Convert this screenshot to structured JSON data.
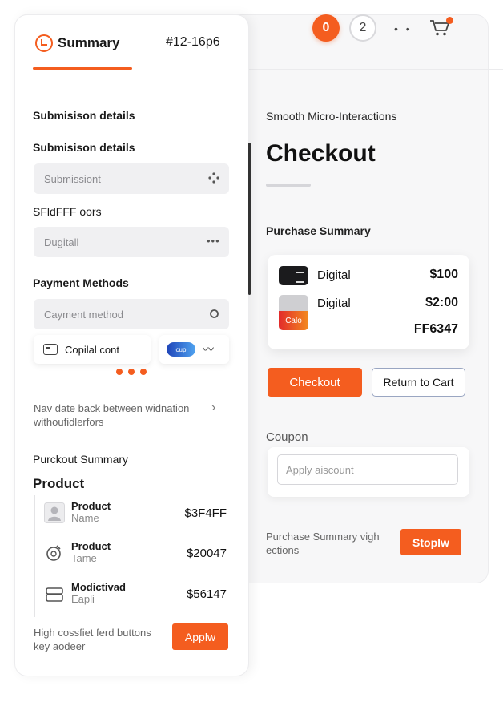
{
  "header": {
    "tab_label": "Summary",
    "order_id": "#12-16p6",
    "badge_active": "0",
    "badge_step": "2",
    "menu_glyph": "•–•",
    "accent": "#f45d1f"
  },
  "sidebar": {
    "submission_heading_1": "Submisison details",
    "submission_heading_2": "Submisison details",
    "submission_placeholder": "Submissiont",
    "sf_label": "SFldFFF  oors",
    "digital_placeholder": "Dugitall",
    "payment_heading": "Payment Methods",
    "payment_placeholder": "Cayment method",
    "chip_card_label": "Copilal cont",
    "chip_toggle_label": "cup",
    "nav_note": "Nav date back between widnation withoufidlerfors",
    "purckout_heading": "Purckout Summary",
    "product_heading": "Product",
    "products": [
      {
        "name": "Product",
        "sub": "Name",
        "price": "$3F4FF",
        "icon": "user-icon"
      },
      {
        "name": "Product",
        "sub": "Tame",
        "price": "$20047",
        "icon": "gift-icon"
      },
      {
        "name": "Modictivad",
        "sub": "Eapli",
        "price": "$56147",
        "icon": "box-icon"
      }
    ],
    "footer_note": "High cossfiet ferd buttons key aodeer",
    "apply_label": "Applw"
  },
  "main": {
    "micro_title": "Smooth Micro-Interactions",
    "page_title": "Checkout",
    "purchase_summary_heading": "Purchase Summary",
    "items": [
      {
        "label": "Digital",
        "price": "$100"
      },
      {
        "label": "Digital",
        "price": "$2:00"
      }
    ],
    "thumb_label": "Calo",
    "total": "FF6347",
    "checkout_label": "Checkout",
    "return_label": "Return to Cart",
    "coupon_label": "Coupon",
    "coupon_placeholder": "Apply aiscount",
    "ps_note": "Purchase Summary vigh ections",
    "stoply_label": "Stoplw"
  }
}
